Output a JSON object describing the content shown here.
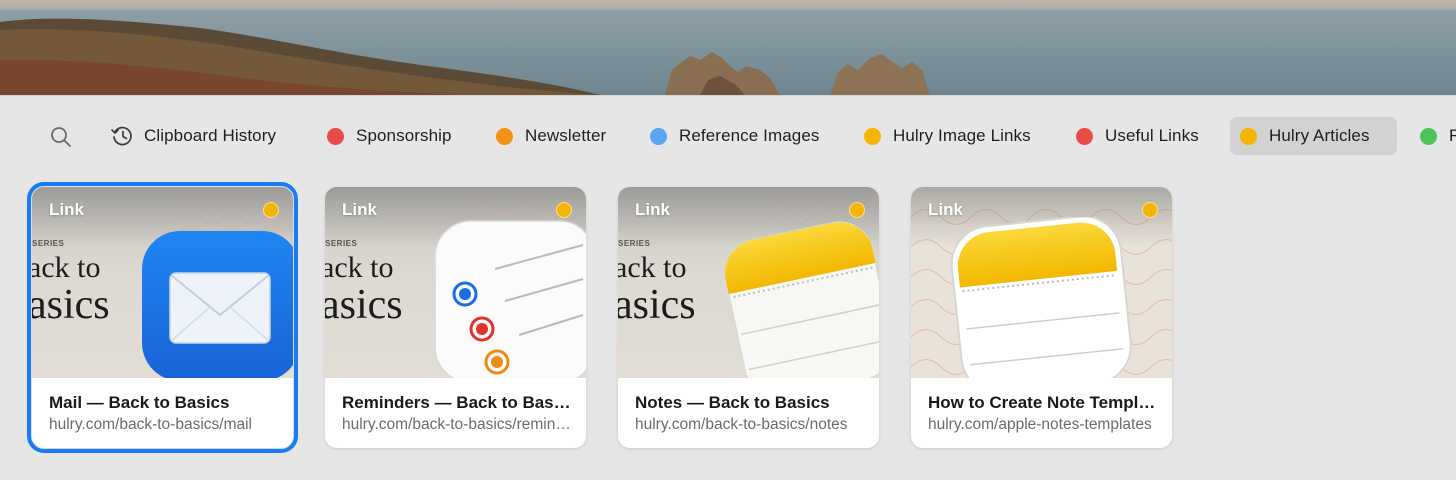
{
  "colors": {
    "accent": "#1a7cf5",
    "red": "#e94b48",
    "orange": "#f39214",
    "blue": "#5aa4f4",
    "yellow": "#f5b400",
    "green": "#4ac35a"
  },
  "tabs": [
    {
      "label": "Clipboard History",
      "icon": "clock-history-icon"
    },
    {
      "label": "Sponsorship",
      "color": "#e94b48"
    },
    {
      "label": "Newsletter",
      "color": "#f39214"
    },
    {
      "label": "Reference Images",
      "color": "#5aa4f4"
    },
    {
      "label": "Hulry Image Links",
      "color": "#f5b400"
    },
    {
      "label": "Useful Links",
      "color": "#e94b48"
    },
    {
      "label": "Hulry Articles",
      "color": "#f5b400",
      "active": true
    },
    {
      "label": "R",
      "color": "#4ac35a"
    }
  ],
  "cards": [
    {
      "type": "Link",
      "series": "SERIES",
      "line1": "ack to",
      "line2": "asics",
      "title": "Mail — Back to Basics",
      "url": "hulry.com/back-to-basics/mail",
      "icon": "mail-app-icon"
    },
    {
      "type": "Link",
      "series": "SERIES",
      "line1": "ack to",
      "line2": "asics",
      "title": "Reminders — Back to Basics",
      "url": "hulry.com/back-to-basics/reminders",
      "icon": "reminders-app-icon"
    },
    {
      "type": "Link",
      "series": "SERIES",
      "line1": "ack to",
      "line2": "asics",
      "title": "Notes — Back to Basics",
      "url": "hulry.com/back-to-basics/notes",
      "icon": "notes-app-icon"
    },
    {
      "type": "Link",
      "title": "How to Create Note Templates",
      "url": "hulry.com/apple-notes-templates",
      "icon": "notes-app-icon"
    }
  ]
}
